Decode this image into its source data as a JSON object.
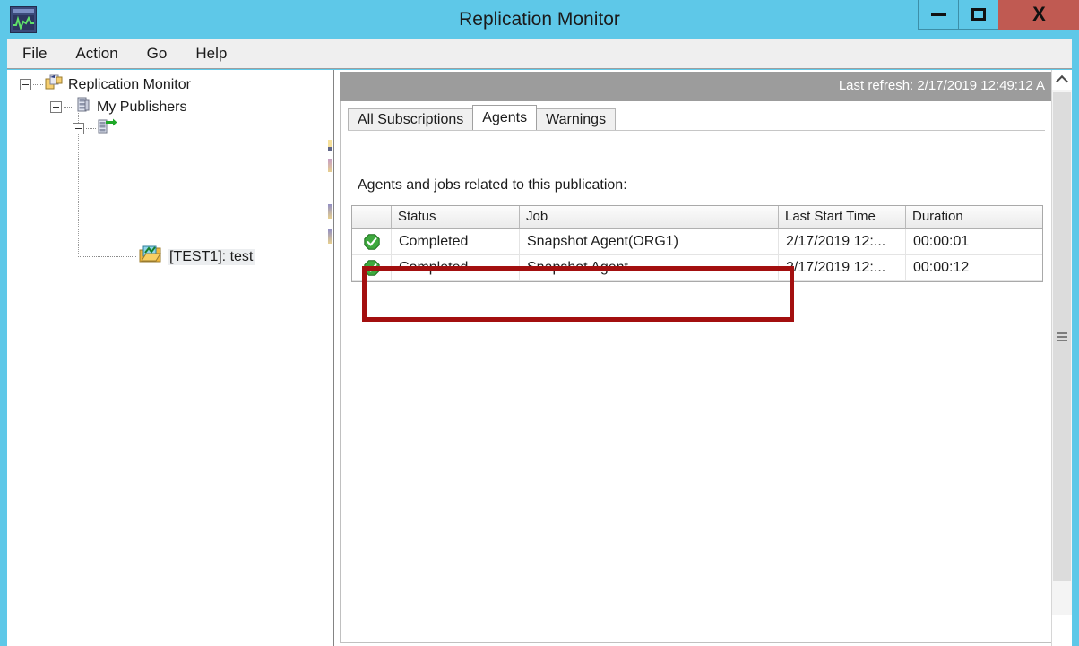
{
  "window": {
    "title": "Replication Monitor",
    "app_icon": "performance-monitor-icon",
    "controls": {
      "minimize": "–",
      "maximize": "□",
      "close": "X"
    },
    "close_color": "#c05a52",
    "titlebar_color": "#5ec8e8"
  },
  "menu": {
    "items": [
      {
        "label": "File"
      },
      {
        "label": "Action"
      },
      {
        "label": "Go"
      },
      {
        "label": "Help"
      }
    ]
  },
  "tree": {
    "nodes": [
      {
        "label": "Replication Monitor",
        "icon": "replication-monitor-icon",
        "expanded": true,
        "depth": 0
      },
      {
        "label": "My Publishers",
        "icon": "publishers-server-icon",
        "expanded": true,
        "depth": 1
      },
      {
        "label": "",
        "icon": "publisher-server-arrow-icon",
        "expanded": true,
        "depth": 2
      },
      {
        "label": "[TEST1]: test",
        "icon": "publication-icon",
        "expanded": false,
        "depth": 3,
        "selected": true
      }
    ]
  },
  "right_panel": {
    "last_refresh": "Last refresh: 2/17/2019 12:49:12 A",
    "tabs": [
      {
        "label": "All Subscriptions",
        "active": false
      },
      {
        "label": "Agents",
        "active": true
      },
      {
        "label": "Warnings",
        "active": false
      }
    ],
    "caption": "Agents and jobs related to this publication:",
    "grid": {
      "columns": [
        "",
        "Status",
        "Job",
        "Last Start Time",
        "Duration",
        ""
      ],
      "rows": [
        {
          "status_icon": "green-check-icon",
          "status": "Completed",
          "job": "Snapshot Agent(ORG1)",
          "last_start_time": "2/17/2019 12:...",
          "duration": "00:00:01"
        },
        {
          "status_icon": "green-check-icon",
          "status": "Completed",
          "job": "Snapshot Agent",
          "last_start_time": "2/17/2019 12:...",
          "duration": "00:00:12"
        }
      ]
    }
  },
  "annotation": {
    "type": "highlight-rectangle",
    "color": "#a30f0f"
  },
  "scrollbar": {
    "up_arrow": "chevron-up-icon",
    "grip": "scrollbar-grip"
  }
}
